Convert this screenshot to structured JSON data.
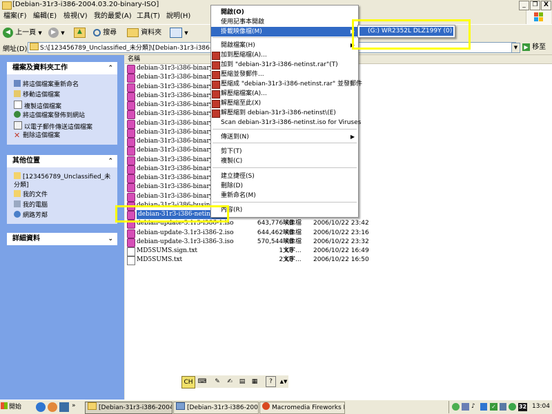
{
  "window": {
    "title": "[Debian-31r3-i386-2004.03.20-binary-ISO]",
    "controls": {
      "minimize": "_",
      "restore": "❐",
      "close": "X"
    }
  },
  "menubar": {
    "items": [
      "檔案(F)",
      "編輯(E)",
      "檢視(V)",
      "我的最愛(A)",
      "工具(T)",
      "說明(H)"
    ]
  },
  "toolbar": {
    "back_label": "上一頁",
    "search_label": "搜尋",
    "folders_label": "資料夾"
  },
  "address": {
    "label": "網址(D)",
    "value": "S:\\[123456789_Unclassified_未分類]\\[Debian-31r3-i386-2004.03.20-binary-ISO]",
    "go_label": "移至"
  },
  "left_panels": {
    "tasks": {
      "title": "檔案及資料夾工作",
      "items": [
        "將這個檔案重新命名",
        "移動這個檔案",
        "複製這個檔案",
        "將這個檔案發佈到網站",
        "以電子郵件傳送這個檔案",
        "刪除這個檔案"
      ]
    },
    "places": {
      "title": "其他位置",
      "items": [
        "[123456789_Unclassified_未分類]",
        "我的文件",
        "我的電腦",
        "網路芳鄰"
      ]
    },
    "details": {
      "title": "詳細資料"
    }
  },
  "filelist": {
    "column_name": "名稱",
    "rows": [
      {
        "name": "debian-31r3-i386-binary-1.iso"
      },
      {
        "name": "debian-31r3-i386-binary-2.iso"
      },
      {
        "name": "debian-31r3-i386-binary-3.iso"
      },
      {
        "name": "debian-31r3-i386-binary-4.iso"
      },
      {
        "name": "debian-31r3-i386-binary-5.iso"
      },
      {
        "name": "debian-31r3-i386-binary-6.iso"
      },
      {
        "name": "debian-31r3-i386-binary-7.iso"
      },
      {
        "name": "debian-31r3-i386-binary-8.iso"
      },
      {
        "name": "debian-31r3-i386-binary-9.iso"
      },
      {
        "name": "debian-31r3-i386-binary-10."
      },
      {
        "name": "debian-31r3-i386-binary-11."
      },
      {
        "name": "debian-31r3-i386-binary-12."
      },
      {
        "name": "debian-31r3-i386-binary-13."
      },
      {
        "name": "debian-31r3-i386-binary-14."
      },
      {
        "name": "debian-31r3-i386-binary-15."
      },
      {
        "name": "debian-31r3-i386-businesscard"
      },
      {
        "name": "debian-31r3-i386-netinst.iso"
      },
      {
        "name": "debian-update-3.1r3-i386-1.iso",
        "size": "643,776 KB",
        "type": "映像檔",
        "date": "2006/10/22 23:42"
      },
      {
        "name": "debian-update-3.1r3-i386-2.iso",
        "size": "644,462 KB",
        "type": "映像檔",
        "date": "2006/10/22 23:16"
      },
      {
        "name": "debian-update-3.1r3-i386-3.iso",
        "size": "570,544 KB",
        "type": "映像檔",
        "date": "2006/10/22 23:32"
      },
      {
        "name": "MD5SUMS.sign.txt",
        "size": "1 KB",
        "type": "文字...",
        "date": "2006/10/22 16:49"
      },
      {
        "name": "MD5SUMS.txt",
        "size": "2 KB",
        "type": "文字...",
        "date": "2006/10/22 16:50"
      }
    ]
  },
  "context_menu": {
    "items": [
      "開啟(O)",
      "使用記事本開啟",
      "掛載映像檔(M)",
      "開啟檔案(H)",
      "加到壓縮檔(A)...",
      "加到 \"debian-31r3-i386-netinst.rar\"(T)",
      "壓縮並發郵件...",
      "壓縮成 \"debian-31r3-i386-netinst.rar\" 並發郵件",
      "解壓縮檔案(A)...",
      "解壓縮至此(X)",
      "解壓縮到 debian-31r3-i386-netinst\\(E)",
      "Scan debian-31r3-i386-netinst.iso for Viruses",
      "傳送到(N)",
      "剪下(T)",
      "複製(C)",
      "建立捷徑(S)",
      "刪除(D)",
      "重新命名(M)",
      "內容(R)"
    ]
  },
  "submenu": {
    "item": "(G:) WR2352L DLZ199Y (0)"
  },
  "langbar": {
    "ime_label": "CH"
  },
  "taskbar": {
    "start_label": "開始",
    "tasks": [
      "[Debian-31r3-i386-2004....",
      "[Debian-31r3-i386-2004....",
      "Macromedia Fireworks M..."
    ],
    "tray_badge": "32",
    "clock": "13:04"
  },
  "colors": {
    "selection": "#316ac5",
    "highlight_box": "#ffff00",
    "left_pane": "#7ba2e7",
    "iso_icon": "#d64fb7"
  }
}
